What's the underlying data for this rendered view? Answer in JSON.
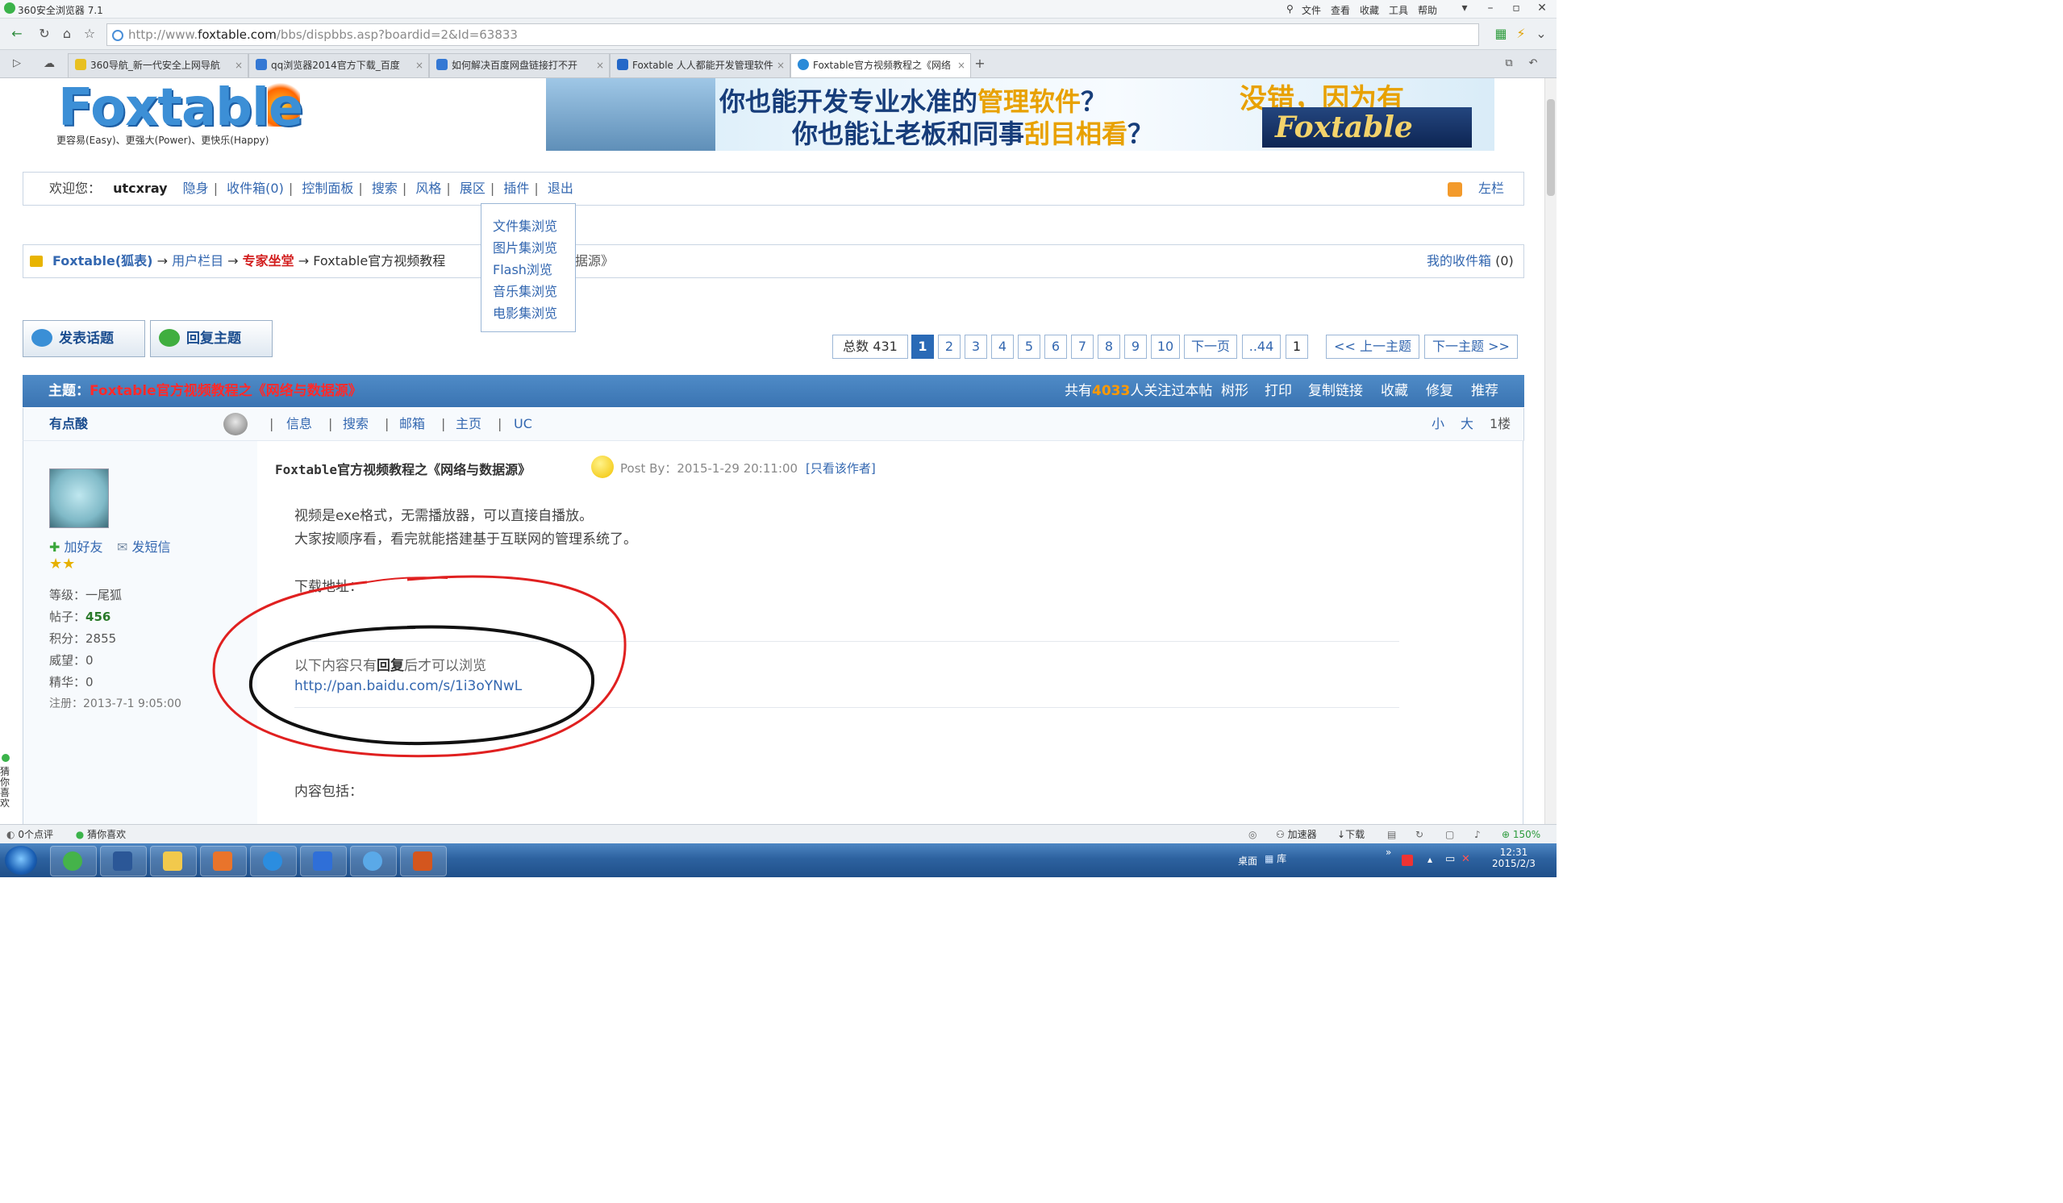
{
  "browser": {
    "title": "360安全浏览器 7.1",
    "menu": [
      "文件",
      "查看",
      "收藏",
      "工具",
      "帮助"
    ],
    "url_prefix": "http://www.",
    "url_domain": "foxtable.com",
    "url_rest": "/bbs/dispbbs.asp?boardid=2&Id=63833",
    "tabs": [
      {
        "label": "360导航_新一代安全上网导航"
      },
      {
        "label": "qq浏览器2014官方下载_百度"
      },
      {
        "label": "如何解决百度网盘链接打不开"
      },
      {
        "label": "Foxtable 人人都能开发管理软件"
      },
      {
        "label": "Foxtable官方视频教程之《网络"
      }
    ]
  },
  "site": {
    "logo_text": "Foxtable",
    "logo_tagline": "更容易(Easy)、更强大(Power)、更快乐(Happy)",
    "banner_line1_a": "你也能开发专业水准的",
    "banner_line1_hl": "管理软件",
    "banner_line1_b": "？",
    "banner_line2_a": "你也能让老板和同事",
    "banner_line2_hl": "刮目相看",
    "banner_line2_b": "？",
    "banner_right": "没错，因为有",
    "banner_brand": "Foxtable"
  },
  "userbar": {
    "welcome": "欢迎您：",
    "username": "utcxray",
    "links": [
      "隐身",
      "收件箱(0)",
      "控制面板",
      "搜索",
      "风格",
      "展区",
      "插件",
      "退出"
    ],
    "right_label": "左栏"
  },
  "dropdown": [
    "文件集浏览",
    "图片集浏览",
    "Flash浏览",
    "音乐集浏览",
    "电影集浏览"
  ],
  "breadcrumb": {
    "home": "Foxtable(狐表)",
    "arrow": "→",
    "c1": "用户栏目",
    "c2": "专家坐堂",
    "title_a": "Foxtable官方视频教程",
    "title_b": "据源》",
    "inbox": "我的收件箱",
    "inbox_count": "(0)"
  },
  "buttons": {
    "new_topic": "发表话题",
    "reply": "回复主题"
  },
  "pager": {
    "total": "总数 431",
    "pages": [
      "1",
      "2",
      "3",
      "4",
      "5",
      "6",
      "7",
      "8",
      "9",
      "10"
    ],
    "next": "下一页",
    "last": "..44",
    "jump": "1",
    "prev_topic": "<< 上一主题",
    "next_topic": "下一主题 >>"
  },
  "thread": {
    "subject_label": "主题：",
    "subject": "Foxtable官方视频教程之《网络与数据源》",
    "watch_a": "共有",
    "watch_count": "4033",
    "watch_b": "人关注过本帖",
    "actions": [
      "树形",
      "打印",
      "复制链接",
      "收藏",
      "修复",
      "推荐"
    ]
  },
  "post": {
    "author": "有点酸",
    "author_links": [
      "信息",
      "搜索",
      "邮箱",
      "主页",
      "UC"
    ],
    "size_small": "小",
    "size_large": "大",
    "floor": "1楼",
    "add_friend": "加好友",
    "send_msg": "发短信",
    "stats": [
      {
        "label": "等级：",
        "value": "一尾狐"
      },
      {
        "label": "帖子：",
        "value": "456"
      },
      {
        "label": "积分：",
        "value": "2855"
      },
      {
        "label": "威望：",
        "value": "0"
      },
      {
        "label": "精华：",
        "value": "0"
      },
      {
        "label": "注册：",
        "value": "2013-7-1 9:05:00"
      }
    ],
    "title": "Foxtable官方视频教程之《网络与数据源》",
    "post_by": "Post By：2015-1-29 20:11:00",
    "only_author": "[只看该作者]",
    "line1": "视频是exe格式，无需播放器，可以直接自播放。",
    "line2": "大家按顺序看，看完就能搭建基于互联网的管理系统了。",
    "download": "下载地址：",
    "hidden_a": "以下内容只有",
    "hidden_b": "回复",
    "hidden_c": "后才可以浏览",
    "link": "http://pan.baidu.com/s/1i3oYNwL",
    "contents": "内容包括："
  },
  "side_vertical": "猜你喜欢",
  "statusbar": {
    "left1": "0个点评",
    "left2": "猜你喜欢",
    "right": [
      "加速器",
      "下载"
    ],
    "zoom": "150%"
  },
  "taskbar": {
    "desktop": "桌面",
    "lib": "库",
    "time": "12:31",
    "date": "2015/2/3"
  },
  "colors": {
    "link": "#3367b0",
    "header_blue": "#3a74b2",
    "red": "#e02020",
    "watch_orange": "#ff9900"
  }
}
